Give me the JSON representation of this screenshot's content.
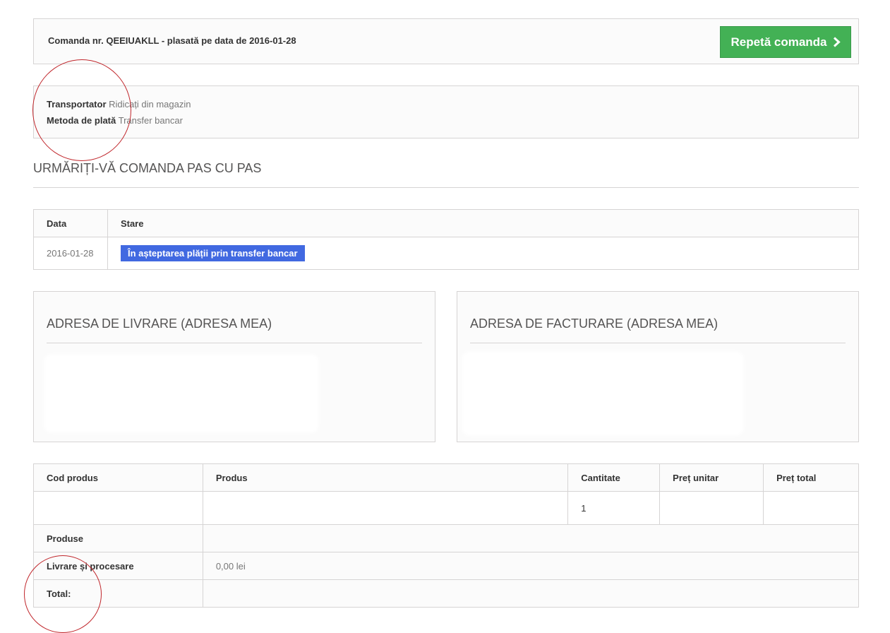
{
  "order": {
    "title": "Comanda nr. QEEIUAKLL - plasată pe data de 2016-01-28",
    "reorder_label": "Repetă comanda"
  },
  "info": {
    "carrier_label": "Transportator",
    "carrier_value": "Ridicați din magazin",
    "payment_label": "Metoda de plată",
    "payment_value": "Transfer bancar"
  },
  "tracking": {
    "title": "URMĂRIȚI-VĂ COMANDA PAS CU PAS",
    "headers": [
      "Data",
      "Stare"
    ],
    "rows": [
      {
        "date": "2016-01-28",
        "status": "În așteptarea plății prin transfer bancar"
      }
    ]
  },
  "addresses": {
    "delivery_title": "ADRESA DE LIVRARE (ADRESA MEA)",
    "billing_title": "ADRESA DE FACTURARE (ADRESA MEA)"
  },
  "products": {
    "headers": [
      "Cod produs",
      "Produs",
      "Cantitate",
      "Preț unitar",
      "Preț total"
    ],
    "rows": [
      {
        "code": "",
        "name": "",
        "qty": "1",
        "unit": "",
        "total": ""
      }
    ],
    "summary": {
      "products_label": "Produse",
      "products_value": "",
      "shipping_label": "Livrare și procesare",
      "shipping_value": "0,00 lei",
      "total_label": "Total:",
      "total_value": ""
    }
  },
  "colors": {
    "reorder_button": "#43b155",
    "status_badge": "#4169e1",
    "annotation_circle": "#c0262b"
  },
  "icons": {
    "reorder": "chevron-right-icon"
  }
}
